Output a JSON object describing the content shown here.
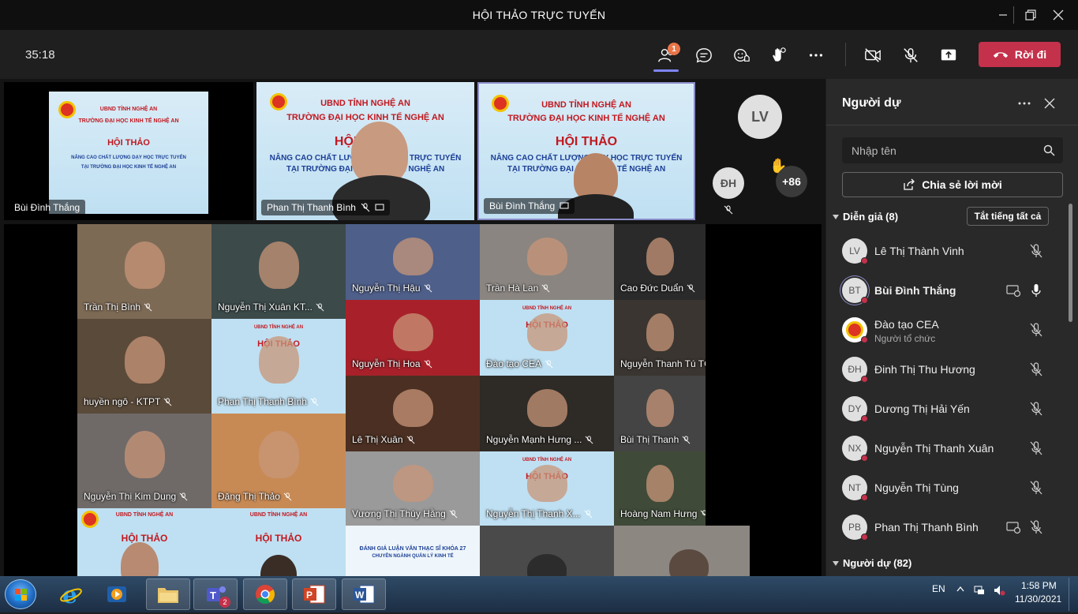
{
  "window": {
    "title": "HỘI THẢO TRỰC TUYẾN"
  },
  "toolbar": {
    "timer": "35:18",
    "participants_badge": "1",
    "leave_label": "Rời đi"
  },
  "stage": {
    "top_tiles": [
      {
        "name": "Bùi Đình Thắng"
      },
      {
        "name": "Phan Thị Thanh Bình"
      },
      {
        "name": "Bùi Đình Thắng"
      }
    ],
    "slide": {
      "line1": "UBND TỈNH NGHỆ AN",
      "line2": "TRƯỜNG ĐẠI HỌC KINH TẾ NGHỆ AN",
      "line3": "HỘI THẢO",
      "line4": "NÂNG CAO CHẤT LƯỢNG DẠY HỌC TRỰC TUYẾN",
      "line5": "TẠI TRƯỜNG ĐẠI HỌC KINH TẾ NGHỆ AN"
    },
    "mini_avatars": {
      "lv": "LV",
      "dh": "ĐH",
      "more": "+86"
    },
    "gallery": [
      {
        "name": "Trần Thị Bình",
        "bg": "#7d6a55"
      },
      {
        "name": "Nguyễn Thị Xuân KT...",
        "bg": "#3c4a4a"
      },
      {
        "name": "Nguyễn Thị Hậu",
        "bg": "#4e5f8a"
      },
      {
        "name": "Trần Hà Lan",
        "bg": "#8a8580"
      },
      {
        "name": "Cao Đức Duẩn",
        "bg": "#2a2a2a"
      },
      {
        "name": "huyền ngô - KTPT",
        "bg": "#5a4a3a"
      },
      {
        "name": "Phan Thị Thanh Bình",
        "bg": "#bfe0f2"
      },
      {
        "name": "Nguyễn Thị Hoa",
        "bg": "#a8212a"
      },
      {
        "name": "Đào tạo CEA",
        "bg": "#bfe0f2"
      },
      {
        "name": "Nguyễn Thanh Tú TC...",
        "bg": "#3a3530"
      },
      {
        "name": "Lê Thị Xuân",
        "bg": "#4a2f22"
      },
      {
        "name": "Nguyễn Mạnh Hưng ...",
        "bg": "#2e2a26"
      },
      {
        "name": "Bùi Thị Thanh",
        "bg": "#444"
      },
      {
        "name": "Nguyễn Thị Kim Dung",
        "bg": "#6f6a68"
      },
      {
        "name": "Đặng Thị Thảo",
        "bg": "#c88a55"
      },
      {
        "name": "Vương Thị Thúy Hằng",
        "bg": "#9a9a9a"
      },
      {
        "name": "Nguyễn Thị Thanh X...",
        "bg": "#bfe0f2"
      },
      {
        "name": "Hoàng Nam Hưng",
        "bg": "#3f4a38"
      }
    ],
    "bottom_slide": {
      "line1": "ĐÁNH GIÁ LUẬN VĂN THẠC SĨ KHÓA 27",
      "line2": "CHUYÊN NGÀNH QUẢN LÝ KINH TẾ"
    }
  },
  "panel": {
    "title": "Người dự",
    "search_placeholder": "Nhập tên",
    "share_label": "Chia sẻ lời mời",
    "presenters_label": "Diễn giả (8)",
    "mute_all_label": "Tắt tiếng tất cả",
    "attendees_label": "Người dự (82)",
    "people": [
      {
        "initials": "LV",
        "name": "Lê Thị Thành Vinh",
        "sub": ""
      },
      {
        "initials": "BT",
        "name": "Bùi Đình Thắng",
        "sub": ""
      },
      {
        "initials": "",
        "name": "Đào tạo CEA",
        "sub": "Người tổ chức"
      },
      {
        "initials": "ĐH",
        "name": "Đinh Thị Thu Hương",
        "sub": ""
      },
      {
        "initials": "DY",
        "name": "Dương Thị Hải Yến",
        "sub": ""
      },
      {
        "initials": "NX",
        "name": "Nguyễn Thị Thanh Xuân",
        "sub": ""
      },
      {
        "initials": "NT",
        "name": "Nguyễn Thị Tùng",
        "sub": ""
      },
      {
        "initials": "PB",
        "name": "Phan Thị Thanh Bình",
        "sub": ""
      }
    ]
  },
  "taskbar": {
    "lang": "EN",
    "time": "1:58 PM",
    "date": "11/30/2021",
    "teams_badge": "2"
  },
  "colors": {
    "leave": "#c4314b",
    "accent": "#7f85f5",
    "badge": "#e97548"
  }
}
